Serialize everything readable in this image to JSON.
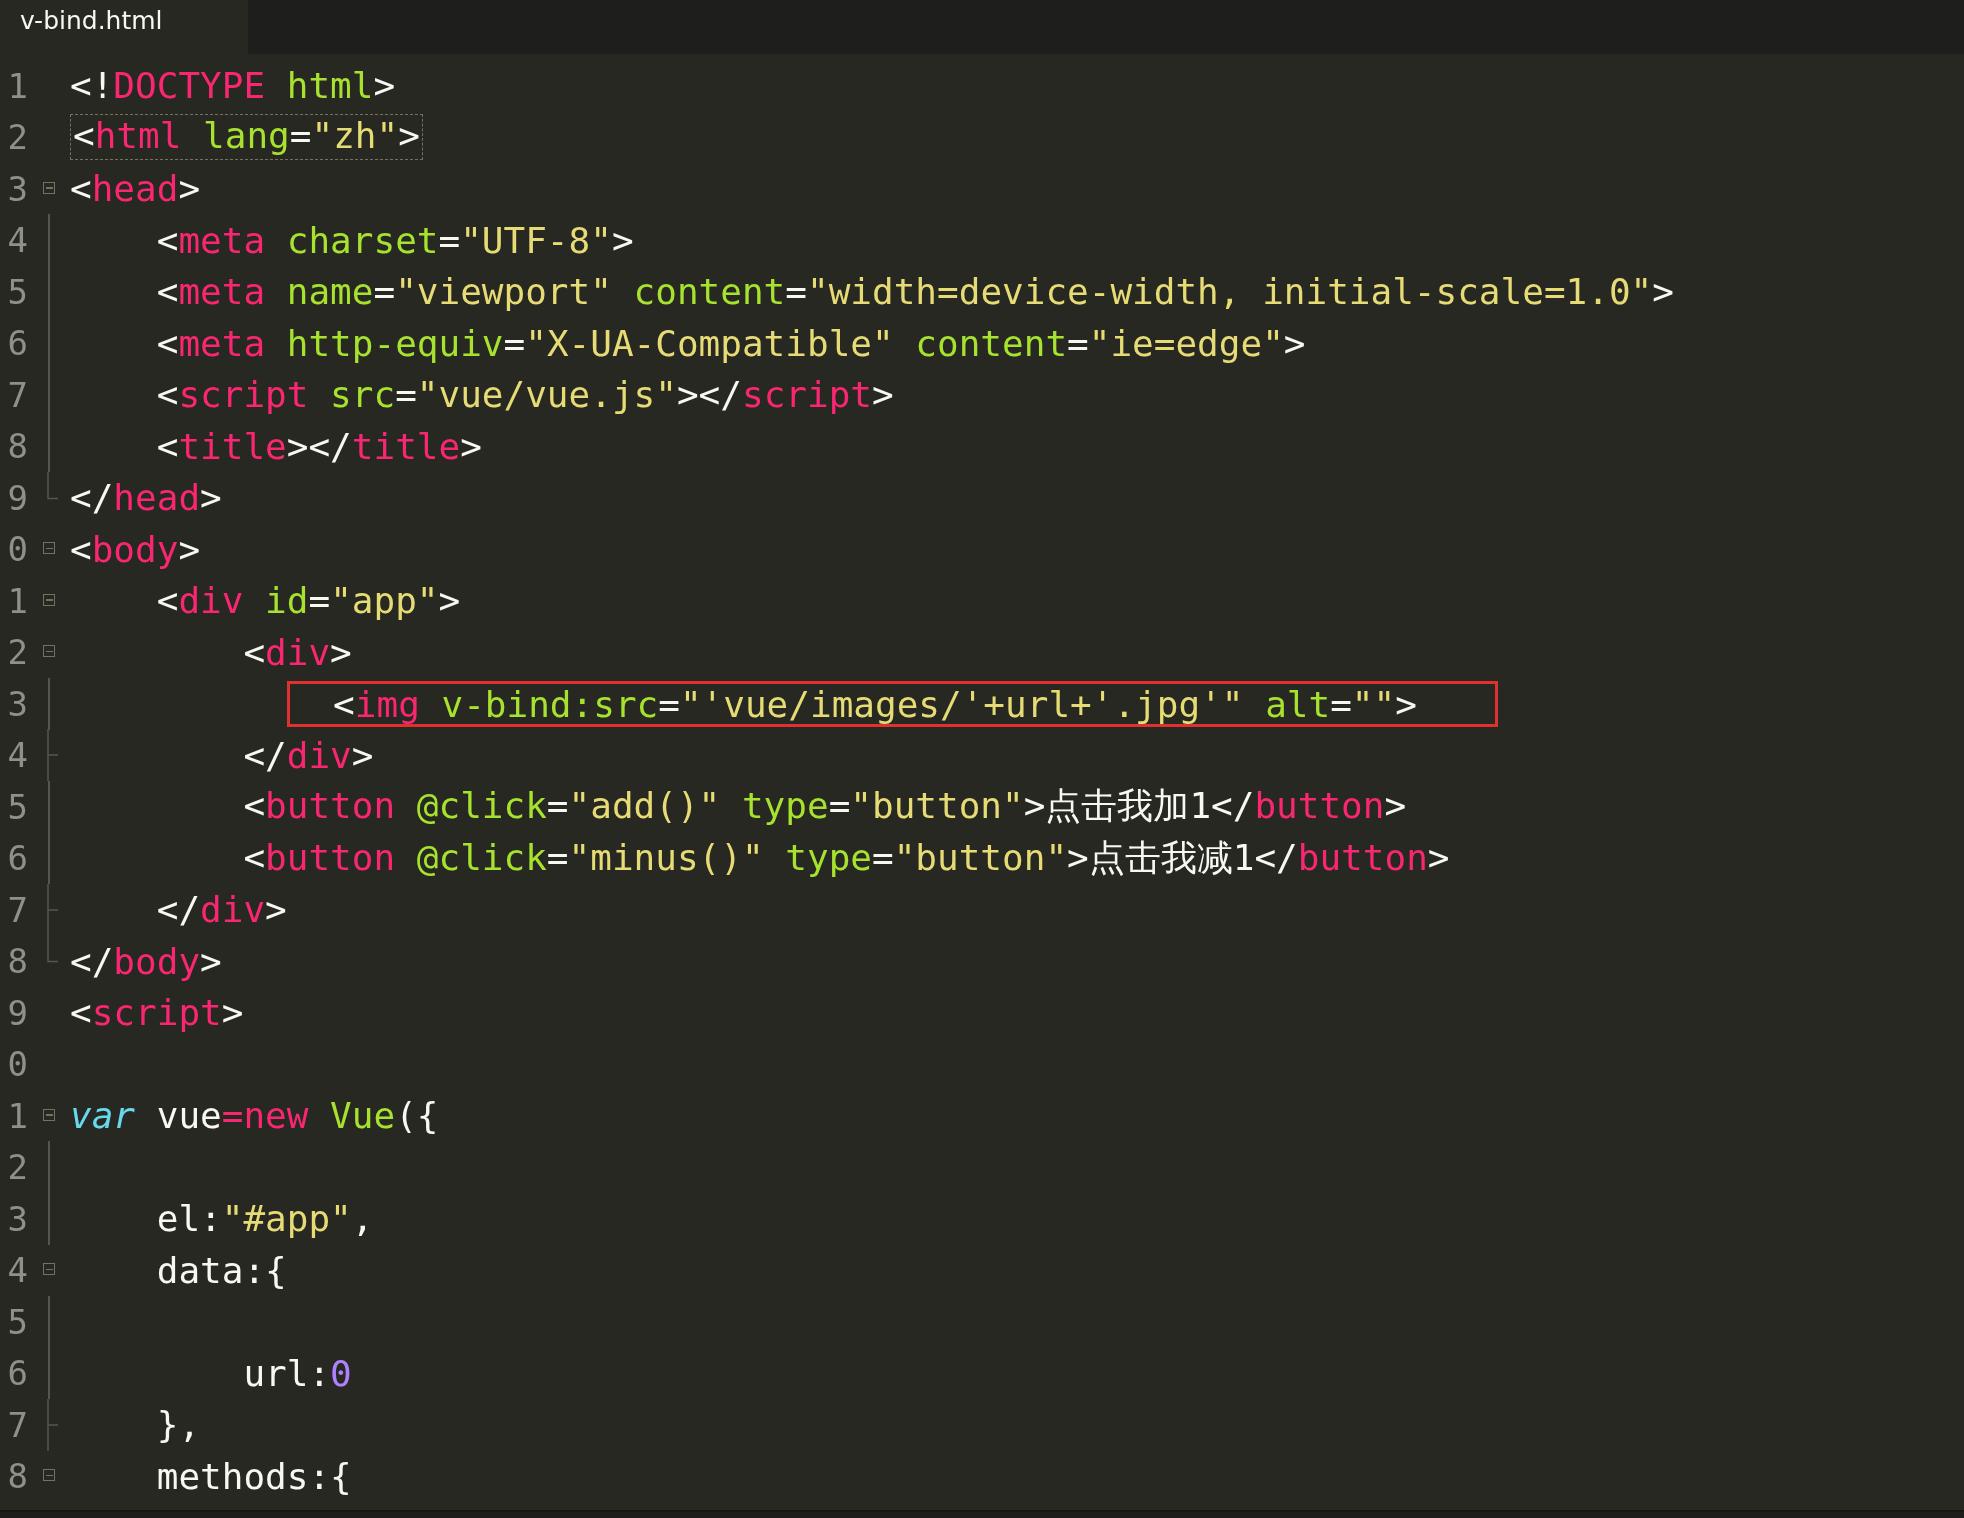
{
  "tab": {
    "title": "v-bind.html",
    "selected": true
  },
  "lines": [
    {
      "n": "1",
      "tokens": [
        {
          "kind": "plain",
          "text": "<!"
        },
        {
          "kind": "tag",
          "text": "DOCTYPE"
        },
        {
          "kind": "attr",
          "text": " html"
        },
        {
          "kind": "plain",
          "text": ">"
        }
      ]
    },
    {
      "n": "2",
      "bracket_outline": true,
      "tokens": [
        {
          "kind": "plain",
          "text": "<"
        },
        {
          "kind": "tag",
          "text": "html"
        },
        {
          "kind": "attr",
          "text": " lang"
        },
        {
          "kind": "plain",
          "text": "="
        },
        {
          "kind": "string",
          "text": "\"zh\""
        },
        {
          "kind": "plain",
          "text": ">"
        }
      ]
    },
    {
      "n": "3",
      "gutter": {
        "kind": "fold"
      },
      "tokens": [
        {
          "kind": "plain",
          "text": "<"
        },
        {
          "kind": "tag",
          "text": "head"
        },
        {
          "kind": "plain",
          "text": ">"
        }
      ]
    },
    {
      "n": "4",
      "gutter": {
        "kind": "line"
      },
      "tokens": [
        {
          "kind": "plain",
          "text": "    <"
        },
        {
          "kind": "tag",
          "text": "meta"
        },
        {
          "kind": "attr",
          "text": " charset"
        },
        {
          "kind": "plain",
          "text": "="
        },
        {
          "kind": "string",
          "text": "\"UTF-8\""
        },
        {
          "kind": "plain",
          "text": ">"
        }
      ]
    },
    {
      "n": "5",
      "gutter": {
        "kind": "line"
      },
      "tokens": [
        {
          "kind": "plain",
          "text": "    <"
        },
        {
          "kind": "tag",
          "text": "meta"
        },
        {
          "kind": "attr",
          "text": " name"
        },
        {
          "kind": "plain",
          "text": "="
        },
        {
          "kind": "string",
          "text": "\"viewport\""
        },
        {
          "kind": "attr",
          "text": " content"
        },
        {
          "kind": "plain",
          "text": "="
        },
        {
          "kind": "string",
          "text": "\"width=device-width, initial-scale=1.0\""
        },
        {
          "kind": "plain",
          "text": ">"
        }
      ]
    },
    {
      "n": "6",
      "gutter": {
        "kind": "line"
      },
      "tokens": [
        {
          "kind": "plain",
          "text": "    <"
        },
        {
          "kind": "tag",
          "text": "meta"
        },
        {
          "kind": "attr",
          "text": " http-equiv"
        },
        {
          "kind": "plain",
          "text": "="
        },
        {
          "kind": "string",
          "text": "\"X-UA-Compatible\""
        },
        {
          "kind": "attr",
          "text": " content"
        },
        {
          "kind": "plain",
          "text": "="
        },
        {
          "kind": "string",
          "text": "\"ie=edge\""
        },
        {
          "kind": "plain",
          "text": ">"
        }
      ]
    },
    {
      "n": "7",
      "gutter": {
        "kind": "line"
      },
      "tokens": [
        {
          "kind": "plain",
          "text": "    <"
        },
        {
          "kind": "tag",
          "text": "script"
        },
        {
          "kind": "attr",
          "text": " src"
        },
        {
          "kind": "plain",
          "text": "="
        },
        {
          "kind": "string",
          "text": "\"vue/vue.js\""
        },
        {
          "kind": "plain",
          "text": "></"
        },
        {
          "kind": "tag",
          "text": "script"
        },
        {
          "kind": "plain",
          "text": ">"
        }
      ]
    },
    {
      "n": "8",
      "gutter": {
        "kind": "line"
      },
      "tokens": [
        {
          "kind": "plain",
          "text": "    <"
        },
        {
          "kind": "tag",
          "text": "title"
        },
        {
          "kind": "plain",
          "text": "></"
        },
        {
          "kind": "tag",
          "text": "title"
        },
        {
          "kind": "plain",
          "text": ">"
        }
      ]
    },
    {
      "n": "9",
      "gutter": {
        "kind": "end"
      },
      "tokens": [
        {
          "kind": "plain",
          "text": "</"
        },
        {
          "kind": "tag",
          "text": "head"
        },
        {
          "kind": "plain",
          "text": ">"
        }
      ]
    },
    {
      "n": "0",
      "gutter": {
        "kind": "fold"
      },
      "tokens": [
        {
          "kind": "plain",
          "text": "<"
        },
        {
          "kind": "tag",
          "text": "body"
        },
        {
          "kind": "plain",
          "text": ">"
        }
      ]
    },
    {
      "n": "1",
      "gutter": {
        "kind": "fold"
      },
      "tokens": [
        {
          "kind": "plain",
          "text": "    <"
        },
        {
          "kind": "tag",
          "text": "div"
        },
        {
          "kind": "attr",
          "text": " id"
        },
        {
          "kind": "plain",
          "text": "="
        },
        {
          "kind": "string",
          "text": "\"app\""
        },
        {
          "kind": "plain",
          "text": ">"
        }
      ]
    },
    {
      "n": "2",
      "gutter": {
        "kind": "fold"
      },
      "tokens": [
        {
          "kind": "plain",
          "text": "        <"
        },
        {
          "kind": "tag",
          "text": "div"
        },
        {
          "kind": "plain",
          "text": ">"
        }
      ]
    },
    {
      "n": "3",
      "gutter": {
        "kind": "line"
      },
      "annotated": true,
      "tokens": [
        {
          "kind": "plain",
          "text": "            <"
        },
        {
          "kind": "tag",
          "text": "img"
        },
        {
          "kind": "attr",
          "text": " v-bind:src"
        },
        {
          "kind": "plain",
          "text": "="
        },
        {
          "kind": "string",
          "text": "\"'vue/images/'+url+'.jpg'\""
        },
        {
          "kind": "attr",
          "text": " alt"
        },
        {
          "kind": "plain",
          "text": "="
        },
        {
          "kind": "string",
          "text": "\"\""
        },
        {
          "kind": "plain",
          "text": ">"
        }
      ]
    },
    {
      "n": "4",
      "gutter": {
        "kind": "tick"
      },
      "tokens": [
        {
          "kind": "plain",
          "text": "        </"
        },
        {
          "kind": "tag",
          "text": "div"
        },
        {
          "kind": "plain",
          "text": ">"
        }
      ]
    },
    {
      "n": "5",
      "gutter": {
        "kind": "line"
      },
      "tokens": [
        {
          "kind": "plain",
          "text": "        <"
        },
        {
          "kind": "tag",
          "text": "button"
        },
        {
          "kind": "attr",
          "text": " @click"
        },
        {
          "kind": "plain",
          "text": "="
        },
        {
          "kind": "string",
          "text": "\"add()\""
        },
        {
          "kind": "attr",
          "text": " type"
        },
        {
          "kind": "plain",
          "text": "="
        },
        {
          "kind": "string",
          "text": "\"button\""
        },
        {
          "kind": "plain",
          "text": ">点击我加1</"
        },
        {
          "kind": "tag",
          "text": "button"
        },
        {
          "kind": "plain",
          "text": ">"
        }
      ]
    },
    {
      "n": "6",
      "gutter": {
        "kind": "line"
      },
      "tokens": [
        {
          "kind": "plain",
          "text": "        <"
        },
        {
          "kind": "tag",
          "text": "button"
        },
        {
          "kind": "attr",
          "text": " @click"
        },
        {
          "kind": "plain",
          "text": "="
        },
        {
          "kind": "string",
          "text": "\"minus()\""
        },
        {
          "kind": "attr",
          "text": " type"
        },
        {
          "kind": "plain",
          "text": "="
        },
        {
          "kind": "string",
          "text": "\"button\""
        },
        {
          "kind": "plain",
          "text": ">点击我减1</"
        },
        {
          "kind": "tag",
          "text": "button"
        },
        {
          "kind": "plain",
          "text": ">"
        }
      ]
    },
    {
      "n": "7",
      "gutter": {
        "kind": "tick"
      },
      "tokens": [
        {
          "kind": "plain",
          "text": "    </"
        },
        {
          "kind": "tag",
          "text": "div"
        },
        {
          "kind": "plain",
          "text": ">"
        }
      ]
    },
    {
      "n": "8",
      "gutter": {
        "kind": "end"
      },
      "tokens": [
        {
          "kind": "plain",
          "text": "</"
        },
        {
          "kind": "tag",
          "text": "body"
        },
        {
          "kind": "plain",
          "text": ">"
        }
      ]
    },
    {
      "n": "9",
      "tokens": [
        {
          "kind": "plain",
          "text": "<"
        },
        {
          "kind": "tag",
          "text": "script"
        },
        {
          "kind": "plain",
          "text": ">"
        }
      ]
    },
    {
      "n": "0"
    },
    {
      "n": "1",
      "gutter": {
        "kind": "fold"
      },
      "tokens": [
        {
          "kind": "keyword",
          "text": "var"
        },
        {
          "kind": "plain",
          "text": " vue"
        },
        {
          "kind": "tag",
          "text": "=new"
        },
        {
          "kind": "attr",
          "text": " Vue"
        },
        {
          "kind": "plain",
          "text": "({"
        }
      ]
    },
    {
      "n": "2",
      "gutter": {
        "kind": "line"
      }
    },
    {
      "n": "3",
      "gutter": {
        "kind": "line"
      },
      "tokens": [
        {
          "kind": "plain",
          "text": "    el:"
        },
        {
          "kind": "string",
          "text": "\"#app\""
        },
        {
          "kind": "plain",
          "text": ","
        }
      ]
    },
    {
      "n": "4",
      "gutter": {
        "kind": "fold"
      },
      "tokens": [
        {
          "kind": "plain",
          "text": "    data:{"
        }
      ]
    },
    {
      "n": "5",
      "gutter": {
        "kind": "line"
      }
    },
    {
      "n": "6",
      "gutter": {
        "kind": "line"
      },
      "tokens": [
        {
          "kind": "plain",
          "text": "        url:"
        },
        {
          "kind": "number",
          "text": "0"
        }
      ]
    },
    {
      "n": "7",
      "gutter": {
        "kind": "tick"
      },
      "tokens": [
        {
          "kind": "plain",
          "text": "    },"
        }
      ]
    },
    {
      "n": "8",
      "gutter": {
        "kind": "fold"
      },
      "tokens": [
        {
          "kind": "plain",
          "text": "    methods:{"
        }
      ]
    }
  ]
}
